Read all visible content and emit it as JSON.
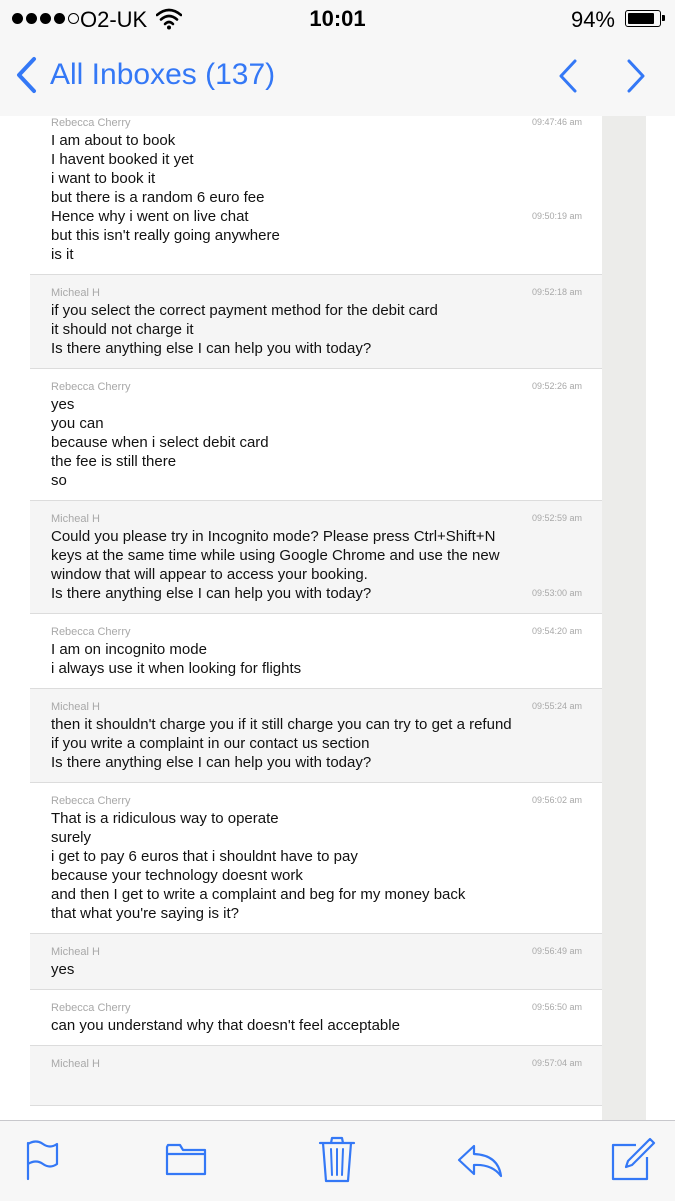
{
  "status_bar": {
    "carrier": "O2-UK",
    "time": "10:01",
    "battery_percent": "94%",
    "battery_level": 0.94,
    "signal_bars_filled": 4,
    "signal_bars_total": 5
  },
  "nav": {
    "title": "All Inboxes (137)",
    "accent_color": "#3478f6",
    "icons": [
      "back-chevron-icon",
      "previous-message-icon",
      "next-message-icon"
    ]
  },
  "messages": [
    {
      "role": "user",
      "sender": "Rebecca Cherry",
      "stamp": "09:47:46 am",
      "second_stamp": "09:50:19 am",
      "lines": [
        "I am about to book",
        "I havent booked it yet",
        "i want to book it",
        "but there is a random 6 euro fee",
        "Hence why i went on live chat",
        "but this isn't really going anywhere",
        "is it"
      ]
    },
    {
      "role": "agent",
      "sender": "Micheal H",
      "stamp": "09:52:18 am",
      "second_stamp": "",
      "lines": [
        "if you select the correct payment method for the debit card",
        "it should not charge it",
        "Is there anything else I can help you with today?"
      ]
    },
    {
      "role": "user",
      "sender": "Rebecca Cherry",
      "stamp": "09:52:26 am",
      "second_stamp": "",
      "lines": [
        "yes",
        "you can",
        "because when i select debit card",
        "the fee is still there",
        "so"
      ]
    },
    {
      "role": "agent",
      "sender": "Micheal H",
      "stamp": "09:52:59 am",
      "second_stamp": "09:53:00 am",
      "lines": [
        "Could you please try in Incognito mode? Please press Ctrl+Shift+N",
        "keys at the same time while using Google Chrome and use the new",
        "window that will appear to access your booking.",
        "Is there anything else I can help you with today?"
      ]
    },
    {
      "role": "user",
      "sender": "Rebecca Cherry",
      "stamp": "09:54:20 am",
      "second_stamp": "",
      "lines": [
        "I am on incognito mode",
        "i always use it when looking for flights"
      ]
    },
    {
      "role": "agent",
      "sender": "Micheal H",
      "stamp": "09:55:24 am",
      "second_stamp": "",
      "lines": [
        "then it shouldn't charge you if it still charge you can try to get a refund",
        "if you write a complaint in our contact us section",
        "Is there anything else I can help you with today?"
      ]
    },
    {
      "role": "user",
      "sender": "Rebecca Cherry",
      "stamp": "09:56:02 am",
      "second_stamp": "",
      "lines": [
        "That is a ridiculous way to operate",
        "surely",
        "i get to pay 6 euros that i shouldnt have to pay",
        "because your technology doesnt work",
        "and then I get to write a complaint and beg for my money back",
        "that what you're saying is it?"
      ]
    },
    {
      "role": "agent",
      "sender": "Micheal H",
      "stamp": "09:56:49 am",
      "second_stamp": "",
      "lines": [
        "yes"
      ]
    },
    {
      "role": "user",
      "sender": "Rebecca Cherry",
      "stamp": "09:56:50 am",
      "second_stamp": "",
      "lines": [
        "can you understand why that doesn't feel acceptable"
      ]
    },
    {
      "role": "agent",
      "sender": "Micheal H",
      "stamp": "09:57:04 am",
      "second_stamp": "",
      "lines": []
    }
  ],
  "toolbar": {
    "icons": [
      "flag-icon",
      "folder-icon",
      "trash-icon",
      "reply-icon",
      "compose-icon"
    ]
  }
}
